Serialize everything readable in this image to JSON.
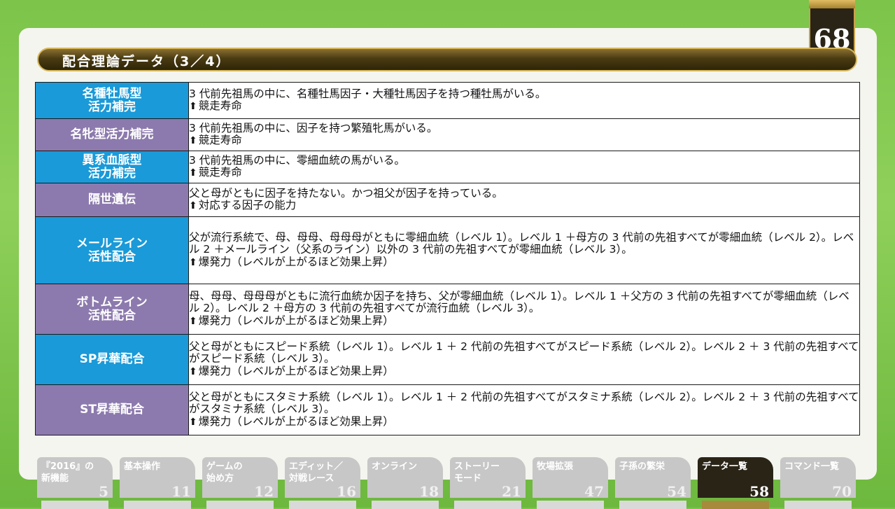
{
  "page_number": "68",
  "section_title": "配合理論データ（3／4）",
  "rows": [
    {
      "label": "名種牡馬型\n活力補完",
      "color": "blue",
      "desc": "3 代前先祖馬の中に、名種牡馬因子・大種牡馬因子を持つ種牡馬がいる。",
      "effect": "競走寿命"
    },
    {
      "label": "名牝型活力補完",
      "color": "purple",
      "desc": "3 代前先祖馬の中に、因子を持つ繁殖牝馬がいる。",
      "effect": "競走寿命"
    },
    {
      "label": "異系血脈型\n活力補完",
      "color": "blue",
      "desc": "3 代前先祖馬の中に、零細血統の馬がいる。",
      "effect": "競走寿命"
    },
    {
      "label": "隔世遺伝",
      "color": "purple",
      "desc": "父と母がともに因子を持たない。かつ祖父が因子を持っている。",
      "effect": "対応する因子の能力"
    },
    {
      "label": "メールライン\n活性配合",
      "color": "blue",
      "desc": "父が流行系統で、母、母母、母母母がともに零細血統（レベル 1）。レベル 1 ＋母方の 3 代前の先祖すべてが零細血統（レベル 2）。レベル 2 ＋メールライン（父系のライン）以外の 3 代前の先祖すべてが零細血統（レベル 3）。",
      "effect": "爆発力（レベルが上がるほど効果上昇）"
    },
    {
      "label": "ボトムライン\n活性配合",
      "color": "purple",
      "desc": "母、母母、母母母がともに流行血統か因子を持ち、父が零細血統（レベル 1）。レベル 1 ＋父方の 3 代前の先祖すべてが零細血統（レベル 2）。レベル 2 ＋母方の 3 代前の先祖すべてが流行血統（レベル 3）。",
      "effect": "爆発力（レベルが上がるほど効果上昇）"
    },
    {
      "label": "SP昇華配合",
      "color": "blue",
      "desc": "父と母がともにスピード系統（レベル 1）。レベル 1 ＋ 2 代前の先祖すべてがスピード系統（レベル 2）。レベル 2 ＋ 3 代前の先祖すべてがスピード系統（レベル 3）。",
      "effect": "爆発力（レベルが上がるほど効果上昇）"
    },
    {
      "label": "ST昇華配合",
      "color": "purple",
      "desc": "父と母がともにスタミナ系統（レベル 1）。レベル 1 ＋ 2 代前の先祖すべてがスタミナ系統（レベル 2）。レベル 2 ＋ 3 代前の先祖すべてがスタミナ系統（レベル 3）。",
      "effect": "爆発力（レベルが上がるほど効果上昇）"
    }
  ],
  "nav": [
    {
      "label": "『2016』の\n新機能",
      "page": "5",
      "active": false
    },
    {
      "label": "基本操作",
      "page": "11",
      "active": false
    },
    {
      "label": "ゲームの\n始め方",
      "page": "12",
      "active": false
    },
    {
      "label": "エディット／\n対戦レース",
      "page": "16",
      "active": false
    },
    {
      "label": "オンライン",
      "page": "18",
      "active": false
    },
    {
      "label": "ストーリー\nモード",
      "page": "21",
      "active": false
    },
    {
      "label": "牧場拡張",
      "page": "47",
      "active": false
    },
    {
      "label": "子孫の繁栄",
      "page": "54",
      "active": false
    },
    {
      "label": "データ一覧",
      "page": "58",
      "active": true
    },
    {
      "label": "コマンド一覧",
      "page": "70",
      "active": false
    }
  ]
}
